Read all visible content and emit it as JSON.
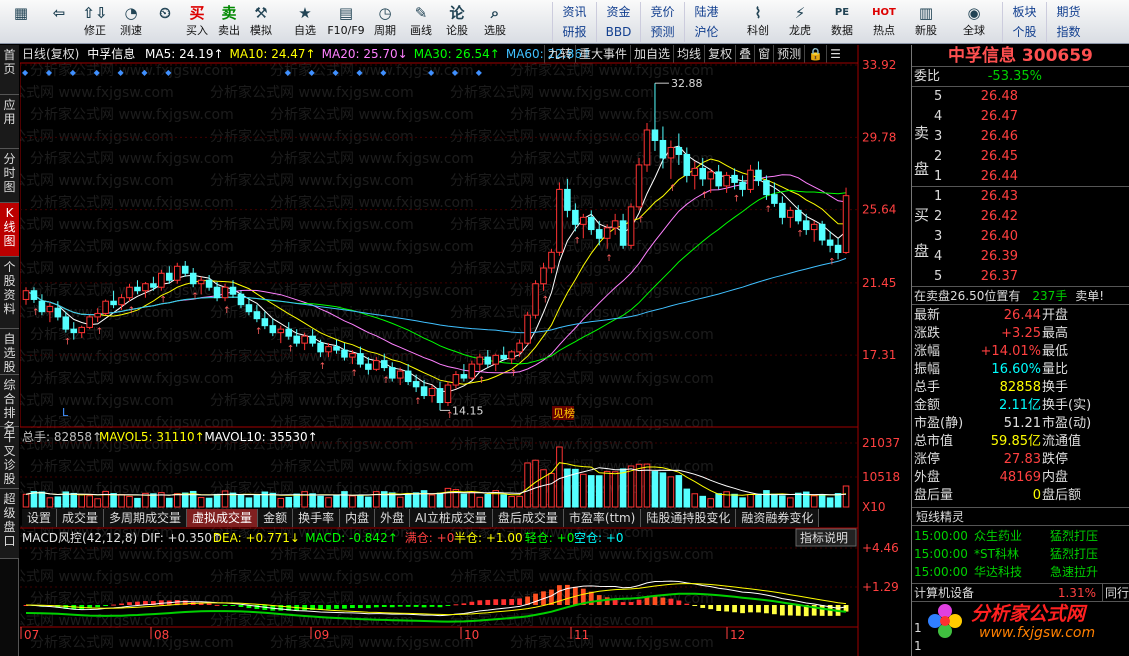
{
  "toolbar": {
    "buttons": [
      {
        "label": "",
        "icon": "▦",
        "name": "grid-icon"
      },
      {
        "label": "",
        "icon": "⇦",
        "name": "back-arrow-icon"
      },
      {
        "label": "修正",
        "icon": "⇧⇩",
        "name": "updown-icon"
      },
      {
        "label": "测速",
        "icon": "◔",
        "name": "speed-icon"
      },
      {
        "label": "",
        "icon": "⏲",
        "name": "clock-icon"
      },
      {
        "label": "买入",
        "icon": "买",
        "name": "buy-icon"
      },
      {
        "label": "卖出",
        "icon": "卖",
        "name": "sell-icon"
      },
      {
        "label": "模拟",
        "icon": "⚒",
        "name": "hammer-icon"
      },
      {
        "label": "自选",
        "icon": "★",
        "name": "star-icon"
      },
      {
        "label": "F10/F9",
        "icon": "▤",
        "name": "f10-icon"
      },
      {
        "label": "周期",
        "icon": "◷",
        "name": "period-icon"
      },
      {
        "label": "画线",
        "icon": "✎",
        "name": "pen-icon"
      },
      {
        "label": "论股",
        "icon": "论",
        "name": "discuss-icon"
      },
      {
        "label": "选股",
        "icon": "⌕",
        "name": "select-stock-icon"
      }
    ],
    "grid": [
      "资讯",
      "资金",
      "竞价",
      "陆港",
      "研报",
      "BBD",
      "预测",
      "沪伦"
    ],
    "buttons2": [
      {
        "label": "科创",
        "icon": "⌇",
        "name": "star-market-icon"
      },
      {
        "label": "龙虎",
        "icon": "⚡",
        "name": "dragon-tiger-icon"
      },
      {
        "label": "数据",
        "icon": "PE",
        "name": "data-icon"
      },
      {
        "label": "热点",
        "icon": "HOT",
        "name": "hot-icon"
      },
      {
        "label": "新股",
        "icon": "▥",
        "name": "new-stock-icon"
      },
      {
        "label": "全球",
        "icon": "◉",
        "name": "globe-icon"
      }
    ],
    "grid2": [
      "板块",
      "期货",
      "个股",
      "指数"
    ]
  },
  "sidebar": [
    "首页",
    "应用",
    "分时图",
    "K线图",
    "个股资料",
    "自选股",
    "综合排名",
    "牛叉诊股",
    "超级盘口"
  ],
  "chart": {
    "period_label": "日线(复权)",
    "stock_name": "中孚信息",
    "ma": [
      {
        "label": "MA5: 24.19↑",
        "color": "#ffffff"
      },
      {
        "label": "MA10: 24.47↑",
        "color": "#ffff00"
      },
      {
        "label": "MA20: 25.70↓",
        "color": "#ff80ff"
      },
      {
        "label": "MA30: 26.54↑",
        "color": "#00ff00"
      },
      {
        "label": "MA60: 22.86↑",
        "color": "#40c0ff"
      }
    ],
    "buttons": [
      "九转",
      "重大事件",
      "加自选",
      "均线",
      "复权",
      "叠",
      "窗",
      "预测",
      "🔒",
      "☰"
    ],
    "price_axis": [
      "33.92",
      "29.78",
      "25.64",
      "21.45",
      "17.31"
    ],
    "high_label": "32.88",
    "low_label": "14.15",
    "tag_l": "L",
    "tag_bang": "见榜",
    "x_labels": [
      "07",
      "08",
      "09",
      "10",
      "11",
      "12"
    ],
    "watermark": "分析家公式网 www.fxjgsw.com",
    "colors": {
      "up": "#ff3333",
      "down": "#54ffff",
      "axis": "#a00000",
      "grid": "#400000"
    }
  },
  "volume": {
    "header": [
      {
        "label": "总手: 82858↑",
        "color": "#c0c0c0"
      },
      {
        "label": "MAVOL5: 31110↑",
        "color": "#ffff00"
      },
      {
        "label": "MAVOL10: 35530↑",
        "color": "#ffffff"
      }
    ],
    "axis": [
      "21037",
      "10518",
      "X10"
    ]
  },
  "indicator_tabs": [
    "设置",
    "成交量",
    "多周期成交量",
    "虚拟成交量",
    "金额",
    "换手率",
    "内盘",
    "外盘",
    "AI立桩成交量",
    "盘后成交量",
    "市盈率(ttm)",
    "陆股通持股变化",
    "融资融券变化"
  ],
  "macd": {
    "header": [
      {
        "label": "MACD风控(42,12,8) DIF: +0.350↑",
        "color": "#e0e0e0"
      },
      {
        "label": "DEA: +0.771↓",
        "color": "#ffff00"
      },
      {
        "label": "MACD: -0.842↑",
        "color": "#00ff00"
      },
      {
        "label": "满仓: +0",
        "color": "#ff4040"
      },
      {
        "label": "半仓: +1.00",
        "color": "#ffff00"
      },
      {
        "label": "轻仓: +0",
        "color": "#00ff00"
      },
      {
        "label": "空仓: +0",
        "color": "#00ffff"
      }
    ],
    "help_button": "指标说明",
    "axis": [
      "+4.46",
      "+1.29"
    ]
  },
  "quote": {
    "title": "中孚信息 300659",
    "weibi_label": "委比",
    "weibi_value": "-53.35%",
    "sell_label": "卖盘",
    "buy_label": "买盘",
    "sell": [
      {
        "lvl": "5",
        "price": "26.48"
      },
      {
        "lvl": "4",
        "price": "26.47"
      },
      {
        "lvl": "3",
        "price": "26.46"
      },
      {
        "lvl": "2",
        "price": "26.45"
      },
      {
        "lvl": "1",
        "price": "26.44"
      }
    ],
    "buy": [
      {
        "lvl": "1",
        "price": "26.43"
      },
      {
        "lvl": "2",
        "price": "26.42"
      },
      {
        "lvl": "3",
        "price": "26.40"
      },
      {
        "lvl": "4",
        "price": "26.39"
      },
      {
        "lvl": "5",
        "price": "26.37"
      }
    ],
    "status_text": "在卖盘26.50位置有",
    "status_vol": "237手",
    "status_tag": "卖单!",
    "fields": [
      {
        "k": "最新",
        "v": "26.44",
        "c": "red",
        "k2": "开盘",
        "v2": ""
      },
      {
        "k": "涨跌",
        "v": "+3.25",
        "c": "red",
        "k2": "最高",
        "v2": ""
      },
      {
        "k": "涨幅",
        "v": "+14.01%",
        "c": "red",
        "k2": "最低",
        "v2": ""
      },
      {
        "k": "振幅",
        "v": "16.60%",
        "c": "cyan",
        "k2": "量比",
        "v2": ""
      },
      {
        "k": "总手",
        "v": "82858",
        "c": "yellow",
        "k2": "换手",
        "v2": ""
      },
      {
        "k": "金额",
        "v": "2.11亿",
        "c": "cyan",
        "k2": "换手(实)",
        "v2": ""
      },
      {
        "k": "市盈(静)",
        "v": "51.21",
        "c": "white",
        "k2": "市盈(动)",
        "v2": ""
      },
      {
        "k": "总市值",
        "v": "59.85亿",
        "c": "yellow",
        "k2": "流通值",
        "v2": ""
      },
      {
        "k": "涨停",
        "v": "27.83",
        "c": "red",
        "k2": "跌停",
        "v2": ""
      },
      {
        "k": "外盘",
        "v": "48169",
        "c": "red",
        "k2": "内盘",
        "v2": ""
      },
      {
        "k": "盘后量",
        "v": "0",
        "c": "yellow",
        "k2": "盘后额",
        "v2": ""
      }
    ],
    "sprite_title": "短线精灵",
    "sprite": [
      {
        "t": "15:00:00",
        "n": "众生药业",
        "e": "猛烈打压"
      },
      {
        "t": "15:00:00",
        "n": "*ST科林",
        "e": "猛烈打压"
      },
      {
        "t": "15:00:00",
        "n": "华达科技",
        "e": "急速拉升"
      }
    ],
    "sector_name": "计算机设备",
    "sector_pct": "1.31%",
    "sector_tab": "同行",
    "bottom_nums": [
      "1",
      "1"
    ]
  },
  "logo": {
    "text": "分析家公式网",
    "url": "www.fxjgsw.com"
  },
  "kdata": [
    [
      20.5,
      21.2,
      20.2,
      21.0
    ],
    [
      21.0,
      21.2,
      20.3,
      20.5
    ],
    [
      20.4,
      20.8,
      19.6,
      19.8
    ],
    [
      19.8,
      20.3,
      19.2,
      20.1
    ],
    [
      20.0,
      20.4,
      19.3,
      19.5
    ],
    [
      19.5,
      19.8,
      18.6,
      18.8
    ],
    [
      18.8,
      19.2,
      18.2,
      18.6
    ],
    [
      18.6,
      19.0,
      18.3,
      18.9
    ],
    [
      18.9,
      19.6,
      18.8,
      19.5
    ],
    [
      19.5,
      20.0,
      19.2,
      19.7
    ],
    [
      19.7,
      20.5,
      19.6,
      20.4
    ],
    [
      20.4,
      21.0,
      20.0,
      20.2
    ],
    [
      20.2,
      20.8,
      19.9,
      20.6
    ],
    [
      20.6,
      21.4,
      20.4,
      21.2
    ],
    [
      21.2,
      21.6,
      20.8,
      21.0
    ],
    [
      21.0,
      21.5,
      20.6,
      21.4
    ],
    [
      21.4,
      21.8,
      21.0,
      21.2
    ],
    [
      21.2,
      22.2,
      21.0,
      22.0
    ],
    [
      22.0,
      22.4,
      21.4,
      21.6
    ],
    [
      21.6,
      22.6,
      21.4,
      22.4
    ],
    [
      22.4,
      22.7,
      21.8,
      22.0
    ],
    [
      22.0,
      22.3,
      21.2,
      21.4
    ],
    [
      21.4,
      21.8,
      20.8,
      21.6
    ],
    [
      21.6,
      21.9,
      21.0,
      21.2
    ],
    [
      21.2,
      21.5,
      20.4,
      20.6
    ],
    [
      20.6,
      21.4,
      20.4,
      21.2
    ],
    [
      21.2,
      21.6,
      20.6,
      20.8
    ],
    [
      20.8,
      21.0,
      20.0,
      20.2
    ],
    [
      20.2,
      20.6,
      19.6,
      19.8
    ],
    [
      19.8,
      20.2,
      19.2,
      19.4
    ],
    [
      19.4,
      19.8,
      18.8,
      19.0
    ],
    [
      19.0,
      19.4,
      18.4,
      18.6
    ],
    [
      18.6,
      19.0,
      18.0,
      18.8
    ],
    [
      18.8,
      19.2,
      18.2,
      18.4
    ],
    [
      18.4,
      18.8,
      17.8,
      18.0
    ],
    [
      18.0,
      18.6,
      17.6,
      18.4
    ],
    [
      18.4,
      18.8,
      17.8,
      18.0
    ],
    [
      18.0,
      18.2,
      17.2,
      17.5
    ],
    [
      17.5,
      18.0,
      17.2,
      17.8
    ],
    [
      17.8,
      18.2,
      17.4,
      17.6
    ],
    [
      17.6,
      18.0,
      17.0,
      17.2
    ],
    [
      17.2,
      17.6,
      16.8,
      17.4
    ],
    [
      17.4,
      17.8,
      16.6,
      16.8
    ],
    [
      16.8,
      17.2,
      16.2,
      16.5
    ],
    [
      16.5,
      17.2,
      16.4,
      17.0
    ],
    [
      17.0,
      17.4,
      16.4,
      16.6
    ],
    [
      16.6,
      16.9,
      15.8,
      16.0
    ],
    [
      16.0,
      16.6,
      15.6,
      16.4
    ],
    [
      16.4,
      16.8,
      15.6,
      15.8
    ],
    [
      15.8,
      16.2,
      15.2,
      15.5
    ],
    [
      15.5,
      15.9,
      14.8,
      15.0
    ],
    [
      15.0,
      15.6,
      14.6,
      15.4
    ],
    [
      15.4,
      15.8,
      14.15,
      14.6
    ],
    [
      14.6,
      15.8,
      14.4,
      15.6
    ],
    [
      15.6,
      16.4,
      15.4,
      16.2
    ],
    [
      16.2,
      16.8,
      15.8,
      16.0
    ],
    [
      16.0,
      17.0,
      15.9,
      16.8
    ],
    [
      16.8,
      17.4,
      16.4,
      17.2
    ],
    [
      17.2,
      17.6,
      16.6,
      16.8
    ],
    [
      16.8,
      17.4,
      16.4,
      17.3
    ],
    [
      17.3,
      17.8,
      17.0,
      17.1
    ],
    [
      17.1,
      17.6,
      16.8,
      17.5
    ],
    [
      17.5,
      18.2,
      17.2,
      18.0
    ],
    [
      18.0,
      19.8,
      17.9,
      19.6
    ],
    [
      19.6,
      21.6,
      19.4,
      21.4
    ],
    [
      21.4,
      22.6,
      21.0,
      22.3
    ],
    [
      22.3,
      23.4,
      22.0,
      23.2
    ],
    [
      23.2,
      27.2,
      23.0,
      26.8
    ],
    [
      26.8,
      27.4,
      25.2,
      25.6
    ],
    [
      25.6,
      26.0,
      24.4,
      24.8
    ],
    [
      24.8,
      25.4,
      24.0,
      25.2
    ],
    [
      25.2,
      25.6,
      24.2,
      24.5
    ],
    [
      24.5,
      25.0,
      23.6,
      24.0
    ],
    [
      24.0,
      24.8,
      23.4,
      24.6
    ],
    [
      24.6,
      25.4,
      24.2,
      25.0
    ],
    [
      25.0,
      25.4,
      23.4,
      23.6
    ],
    [
      23.6,
      26.0,
      23.4,
      25.8
    ],
    [
      25.8,
      28.6,
      25.6,
      28.2
    ],
    [
      28.2,
      30.6,
      27.8,
      30.2
    ],
    [
      30.2,
      32.88,
      29.0,
      29.6
    ],
    [
      29.6,
      30.4,
      28.0,
      28.6
    ],
    [
      28.6,
      29.6,
      27.4,
      29.2
    ],
    [
      29.2,
      30.0,
      28.2,
      28.8
    ],
    [
      28.8,
      29.2,
      27.2,
      27.6
    ],
    [
      27.6,
      28.4,
      26.8,
      28.0
    ],
    [
      28.0,
      28.6,
      27.0,
      27.4
    ],
    [
      27.4,
      28.0,
      26.6,
      27.8
    ],
    [
      27.8,
      28.2,
      26.8,
      27.0
    ],
    [
      27.0,
      27.8,
      26.6,
      27.6
    ],
    [
      27.6,
      28.0,
      26.8,
      27.2
    ],
    [
      27.2,
      27.6,
      26.4,
      26.8
    ],
    [
      26.8,
      28.2,
      26.6,
      27.9
    ],
    [
      27.9,
      28.4,
      27.0,
      27.3
    ],
    [
      27.3,
      27.6,
      26.2,
      26.5
    ],
    [
      26.5,
      27.2,
      25.8,
      26.0
    ],
    [
      26.0,
      26.4,
      24.8,
      25.2
    ],
    [
      25.2,
      25.8,
      24.6,
      25.6
    ],
    [
      25.6,
      25.9,
      24.8,
      25.0
    ],
    [
      25.0,
      25.4,
      24.2,
      24.5
    ],
    [
      24.5,
      25.0,
      23.8,
      24.8
    ],
    [
      24.8,
      25.0,
      23.6,
      23.9
    ],
    [
      23.9,
      24.4,
      23.2,
      23.6
    ],
    [
      23.6,
      24.0,
      22.8,
      23.19
    ],
    [
      23.19,
      26.9,
      23.1,
      26.44
    ]
  ]
}
